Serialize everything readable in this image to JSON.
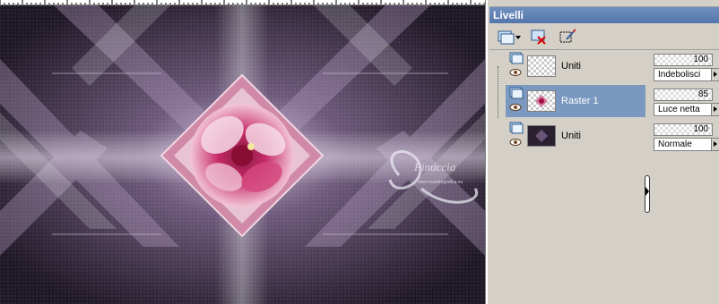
{
  "panel": {
    "title": "Livelli",
    "toolbar": {
      "new_layer_icon": "new-raster-layer-icon",
      "delete_icon": "delete-layer-icon",
      "mask_icon": "selection-mask-icon"
    }
  },
  "layers": [
    {
      "name": "Uniti",
      "opacity": "100",
      "blend_mode": "Indebolisci",
      "selected": false,
      "thumb": "transparent"
    },
    {
      "name": "Raster 1",
      "opacity": "85",
      "blend_mode": "Luce netta",
      "selected": true,
      "thumb": "transparent"
    },
    {
      "name": "Uniti",
      "opacity": "100",
      "blend_mode": "Normale",
      "selected": false,
      "thumb": "dark"
    }
  ],
  "watermark": {
    "name": "Pinuccia",
    "url": "www.maidiregrafica.eu"
  },
  "colors": {
    "panel_bg": "#d4d0c8",
    "title_bar": "#5f80b2",
    "selected_row": "#7a98c0",
    "canvas_dark": "#2a2130",
    "canvas_light": "#8f78a0",
    "flower": "#c2185b"
  }
}
